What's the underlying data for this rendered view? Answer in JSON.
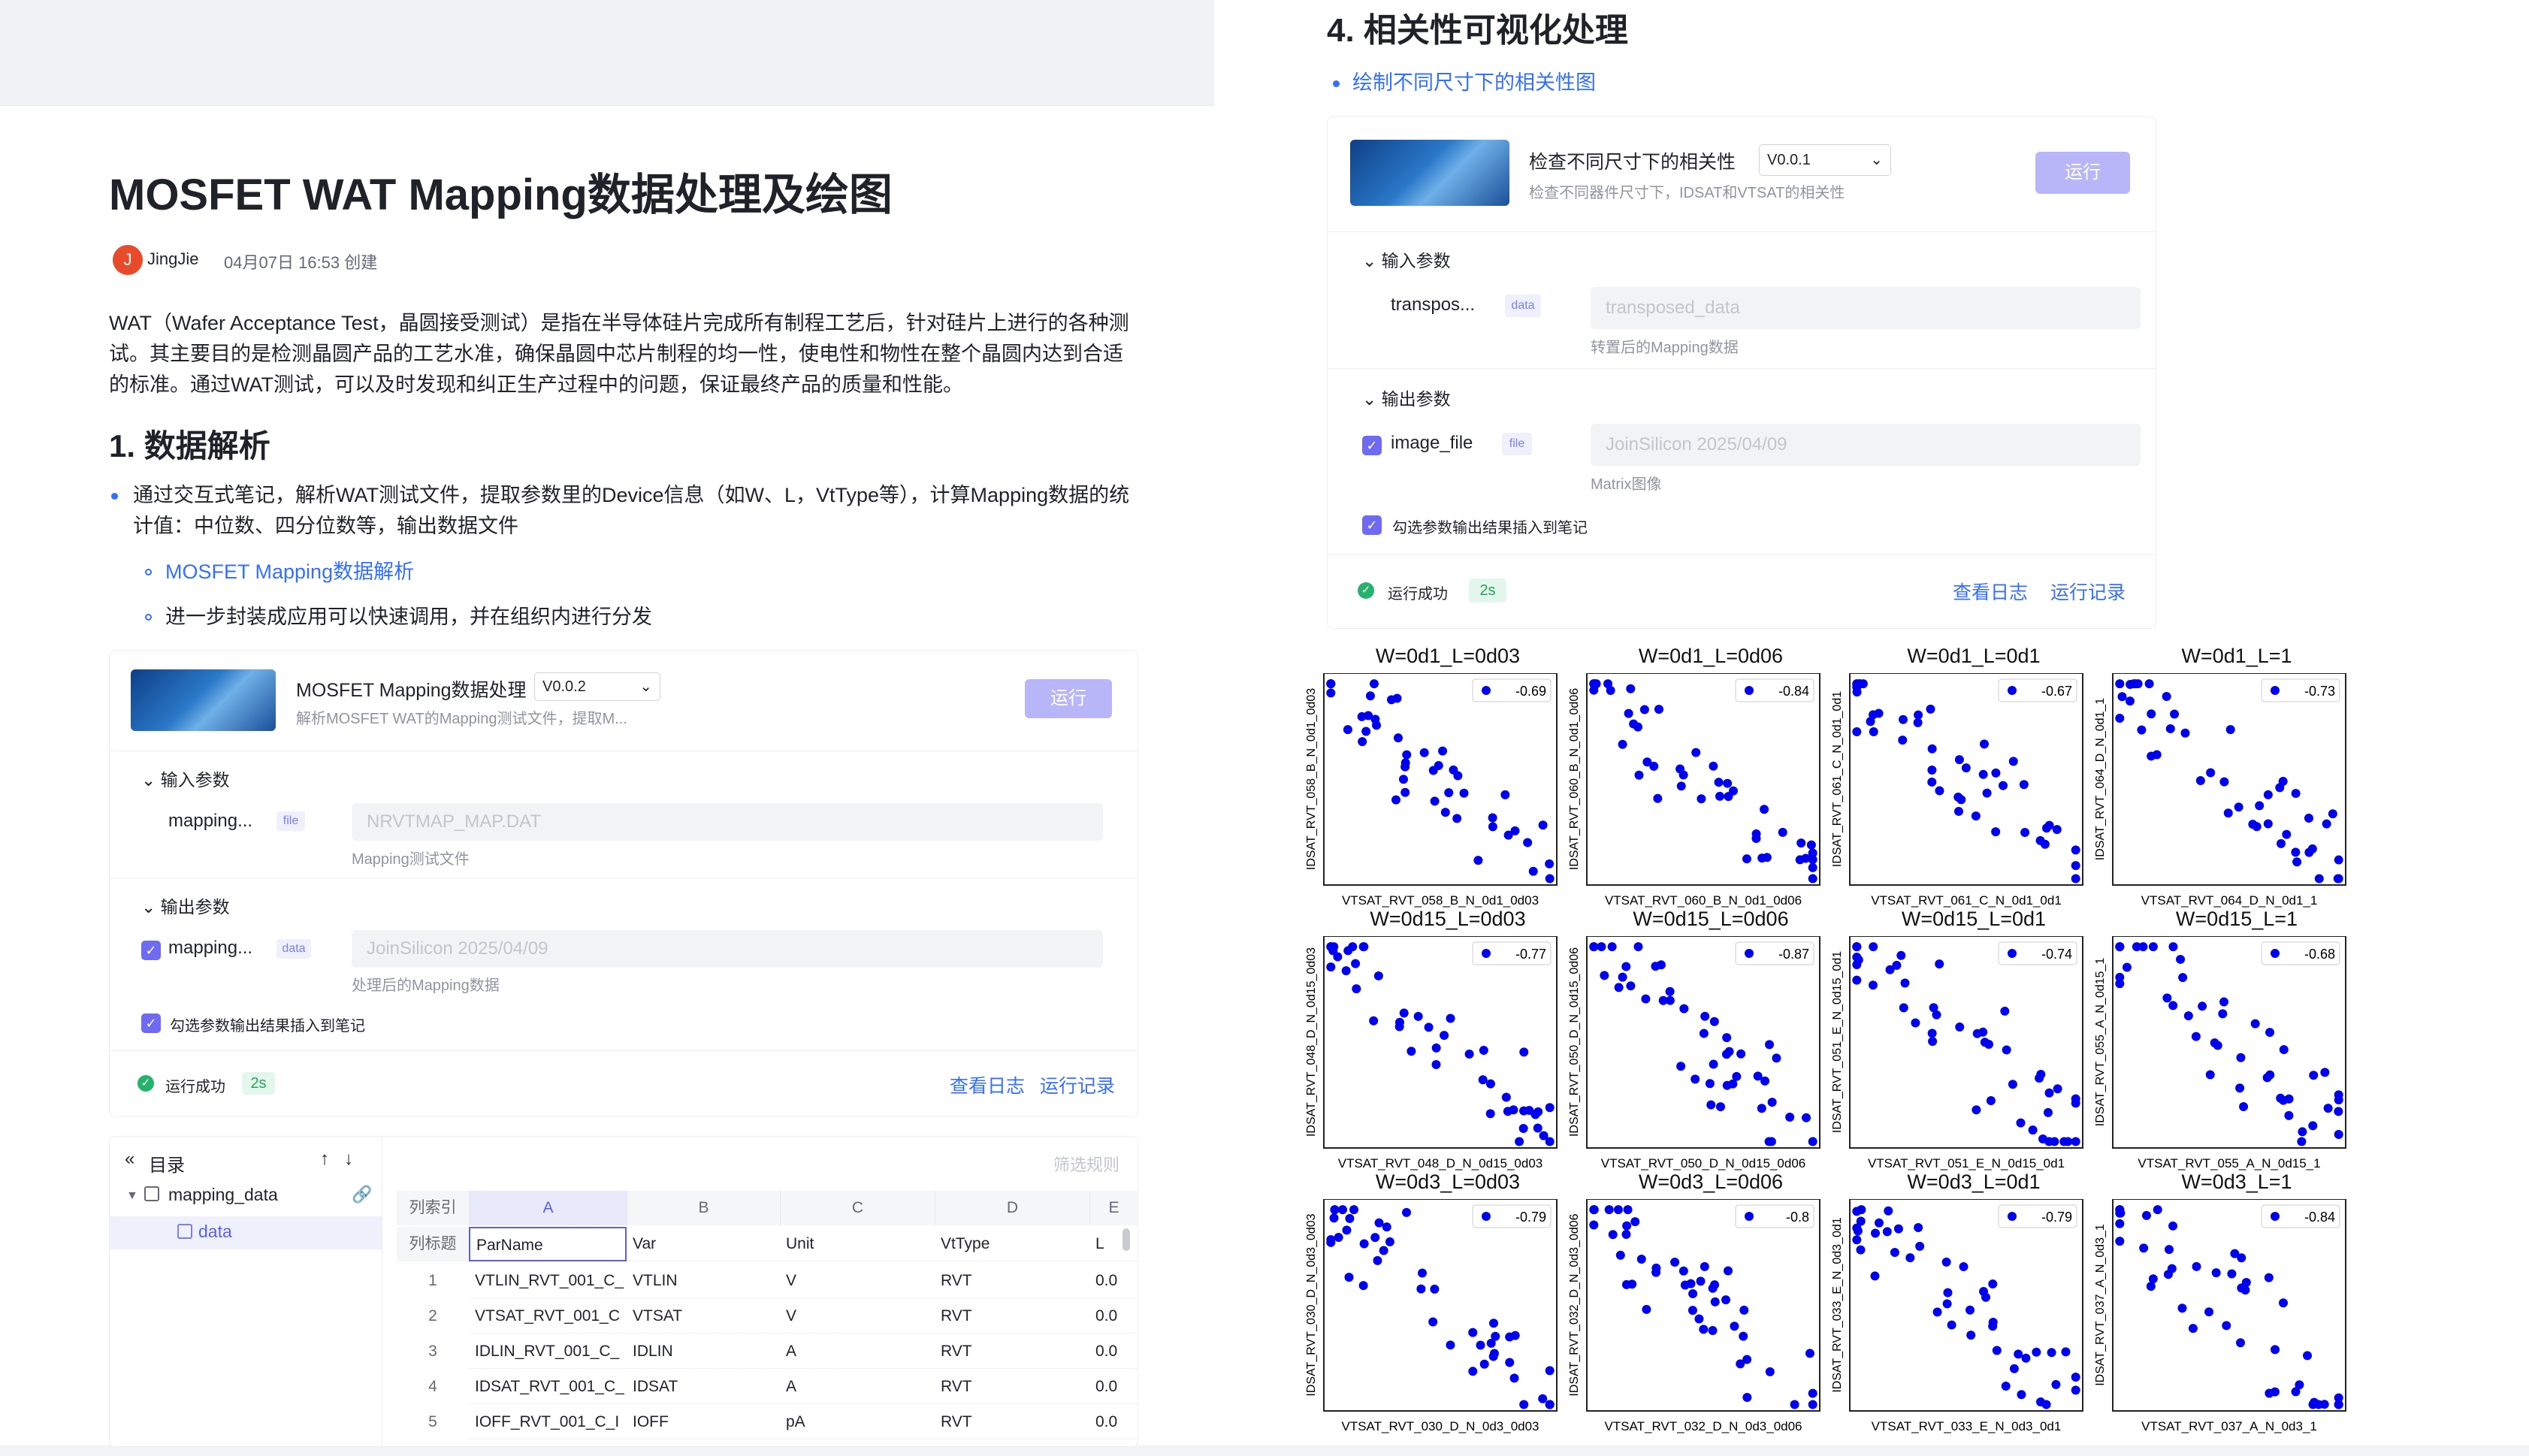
{
  "left": {
    "doc_title": "MOSFET WAT Mapping数据处理及绘图",
    "author_initial": "J",
    "author": "JingJie",
    "created": "04月07日 16:53 创建",
    "intro": "WAT（Wafer Acceptance Test，晶圆接受测试）是指在半导体硅片完成所有制程工艺后，针对硅片上进行的各种测试。其主要目的是检测晶圆产品的工艺水准，确保晶圆中芯片制程的均一性，使电性和物性在整个晶圆内达到合适的标准。通过WAT测试，可以及时发现和纠正生产过程中的问题，保证最终产品的质量和性能。",
    "section1": "1. 数据解析",
    "bullet1": "通过交互式笔记，解析WAT测试文件，提取参数里的Device信息（如W、L，VtType等），计算Mapping数据的统计值：中位数、四分位数等，输出数据文件",
    "sub_link": "MOSFET Mapping数据解析",
    "sub_text": "进一步封装成应用可以快速调用，并在组织内进行分发",
    "app": {
      "name": "MOSFET Mapping数据处理",
      "version": "V0.0.2",
      "desc": "解析MOSFET WAT的Mapping测试文件，提取M...",
      "run": "运行",
      "input_section": "输入参数",
      "input_name": "mapping...",
      "input_tag": "file",
      "input_value": "NRVTMAP_MAP.DAT",
      "input_hint": "Mapping测试文件",
      "output_section": "输出参数",
      "output_name": "mapping...",
      "output_tag": "data",
      "output_value": "JoinSilicon 2025/04/09",
      "output_hint": "处理后的Mapping数据",
      "insert_label": "勾选参数输出结果插入到笔记",
      "status": "运行成功",
      "duration": "2s",
      "view_log": "查看日志",
      "run_history": "运行记录"
    },
    "toc": {
      "title": "目录",
      "filter": "筛选规则",
      "node": "mapping_data",
      "child": "data"
    },
    "table": {
      "corner_top": "列索引",
      "corner_bottom": "列标题",
      "col_letters": [
        "A",
        "B",
        "C",
        "D",
        "E"
      ],
      "col_titles": [
        "ParName",
        "Var",
        "Unit",
        "VtType",
        "L"
      ],
      "rows": [
        {
          "idx": "1",
          "cells": [
            "VTLIN_RVT_001_C_",
            "VTLIN",
            "V",
            "RVT",
            "0.0"
          ]
        },
        {
          "idx": "2",
          "cells": [
            "VTSAT_RVT_001_C",
            "VTSAT",
            "V",
            "RVT",
            "0.0"
          ]
        },
        {
          "idx": "3",
          "cells": [
            "IDLIN_RVT_001_C_",
            "IDLIN",
            "A",
            "RVT",
            "0.0"
          ]
        },
        {
          "idx": "4",
          "cells": [
            "IDSAT_RVT_001_C_",
            "IDSAT",
            "A",
            "RVT",
            "0.0"
          ]
        },
        {
          "idx": "5",
          "cells": [
            "IOFF_RVT_001_C_I",
            "IOFF",
            "pA",
            "RVT",
            "0.0"
          ]
        }
      ]
    }
  },
  "right": {
    "section4": "4. 相关性可视化处理",
    "bullet": "绘制不同尺寸下的相关性图",
    "app": {
      "name": "检查不同尺寸下的相关性",
      "version": "V0.0.1",
      "desc": "检查不同器件尺寸下，IDSAT和VTSAT的相关性",
      "run": "运行",
      "input_section": "输入参数",
      "input_name": "transpos...",
      "input_tag": "data",
      "input_value": "transposed_data",
      "input_hint": "转置后的Mapping数据",
      "output_section": "输出参数",
      "output_name": "image_file",
      "output_tag": "file",
      "output_value": "JoinSilicon 2025/04/09",
      "output_hint": "Matrix图像",
      "insert_label": "勾选参数输出结果插入到笔记",
      "status": "运行成功",
      "duration": "2s",
      "view_log": "查看日志",
      "run_history": "运行记录"
    }
  },
  "colors": {
    "accent": "#3370ff",
    "run_button": "#b8b6f8",
    "checkbox": "#6f6af2",
    "success": "#25b36b",
    "scatter_point": "#0000ee"
  },
  "chart_data": [
    {
      "type": "scatter",
      "title": "W=0d1_L=0d03",
      "xlabel": "VTSAT_RVT_058_B_N_0d1_0d03",
      "ylabel": "IDSAT_RVT_058_B_N_0d1_0d03",
      "corr": "-0.69"
    },
    {
      "type": "scatter",
      "title": "W=0d1_L=0d06",
      "xlabel": "VTSAT_RVT_060_B_N_0d1_0d06",
      "ylabel": "IDSAT_RVT_060_B_N_0d1_0d06",
      "corr": "-0.84"
    },
    {
      "type": "scatter",
      "title": "W=0d1_L=0d1",
      "xlabel": "VTSAT_RVT_061_C_N_0d1_0d1",
      "ylabel": "IDSAT_RVT_061_C_N_0d1_0d1",
      "corr": "-0.67"
    },
    {
      "type": "scatter",
      "title": "W=0d1_L=1",
      "xlabel": "VTSAT_RVT_064_D_N_0d1_1",
      "ylabel": "IDSAT_RVT_064_D_N_0d1_1",
      "corr": "-0.73"
    },
    {
      "type": "scatter",
      "title": "W=0d15_L=0d03",
      "xlabel": "VTSAT_RVT_048_D_N_0d15_0d03",
      "ylabel": "IDSAT_RVT_048_D_N_0d15_0d03",
      "corr": "-0.77"
    },
    {
      "type": "scatter",
      "title": "W=0d15_L=0d06",
      "xlabel": "VTSAT_RVT_050_D_N_0d15_0d06",
      "ylabel": "IDSAT_RVT_050_D_N_0d15_0d06",
      "corr": "-0.87"
    },
    {
      "type": "scatter",
      "title": "W=0d15_L=0d1",
      "xlabel": "VTSAT_RVT_051_E_N_0d15_0d1",
      "ylabel": "IDSAT_RVT_051_E_N_0d15_0d1",
      "corr": "-0.74"
    },
    {
      "type": "scatter",
      "title": "W=0d15_L=1",
      "xlabel": "VTSAT_RVT_055_A_N_0d15_1",
      "ylabel": "IDSAT_RVT_055_A_N_0d15_1",
      "corr": "-0.68"
    },
    {
      "type": "scatter",
      "title": "W=0d3_L=0d03",
      "xlabel": "VTSAT_RVT_030_D_N_0d3_0d03",
      "ylabel": "IDSAT_RVT_030_D_N_0d3_0d03",
      "corr": "-0.79"
    },
    {
      "type": "scatter",
      "title": "W=0d3_L=0d06",
      "xlabel": "VTSAT_RVT_032_D_N_0d3_0d06",
      "ylabel": "IDSAT_RVT_032_D_N_0d3_0d06",
      "corr": "-0.8"
    },
    {
      "type": "scatter",
      "title": "W=0d3_L=0d1",
      "xlabel": "VTSAT_RVT_033_E_N_0d3_0d1",
      "ylabel": "IDSAT_RVT_033_E_N_0d3_0d1",
      "corr": "-0.79"
    },
    {
      "type": "scatter",
      "title": "W=0d3_L=1",
      "xlabel": "VTSAT_RVT_037_A_N_0d3_1",
      "ylabel": "IDSAT_RVT_037_A_N_0d3_1",
      "corr": "-0.84"
    }
  ]
}
